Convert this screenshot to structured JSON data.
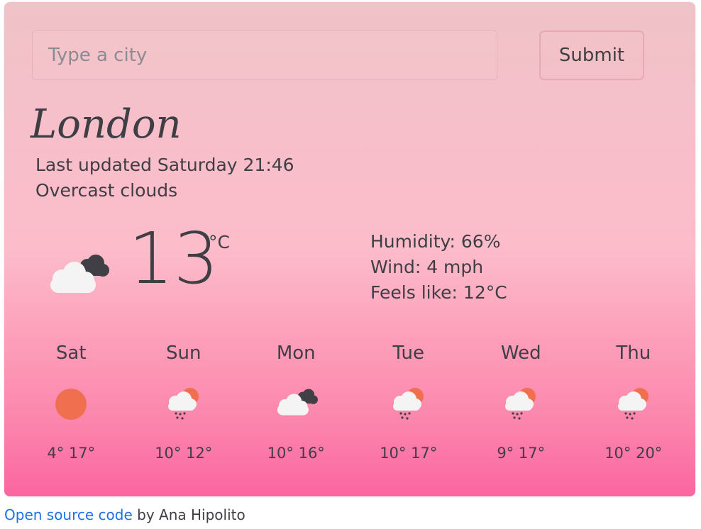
{
  "search": {
    "placeholder": "Type a city",
    "submit_label": "Submit"
  },
  "city": "London",
  "updated": "Last updated Saturday 21:46",
  "description": "Overcast clouds",
  "current": {
    "temp": "13",
    "unit": "°C",
    "icon": "overcast-clouds-icon"
  },
  "details": {
    "humidity": "Humidity: 66%",
    "wind": "Wind: 4 mph",
    "feels_like": "Feels like: 12°C"
  },
  "forecast": [
    {
      "day": "Sat",
      "icon": "sun-icon",
      "temps": "4° 17°"
    },
    {
      "day": "Sun",
      "icon": "rain-sun-cloud-icon",
      "temps": "10° 12°"
    },
    {
      "day": "Mon",
      "icon": "overcast-clouds-icon",
      "temps": "10° 16°"
    },
    {
      "day": "Tue",
      "icon": "rain-sun-cloud-icon",
      "temps": "10° 17°"
    },
    {
      "day": "Wed",
      "icon": "rain-sun-cloud-icon",
      "temps": "9° 17°"
    },
    {
      "day": "Thu",
      "icon": "rain-sun-cloud-icon",
      "temps": "10° 20°"
    }
  ],
  "footer": {
    "link_text": "Open source code",
    "by_text": " by Ana Hipolito"
  },
  "colors": {
    "text": "#3e3e44",
    "sun": "#ef6f4f",
    "link": "#1f6feb",
    "gradient_bottom": "#fb65a0"
  }
}
